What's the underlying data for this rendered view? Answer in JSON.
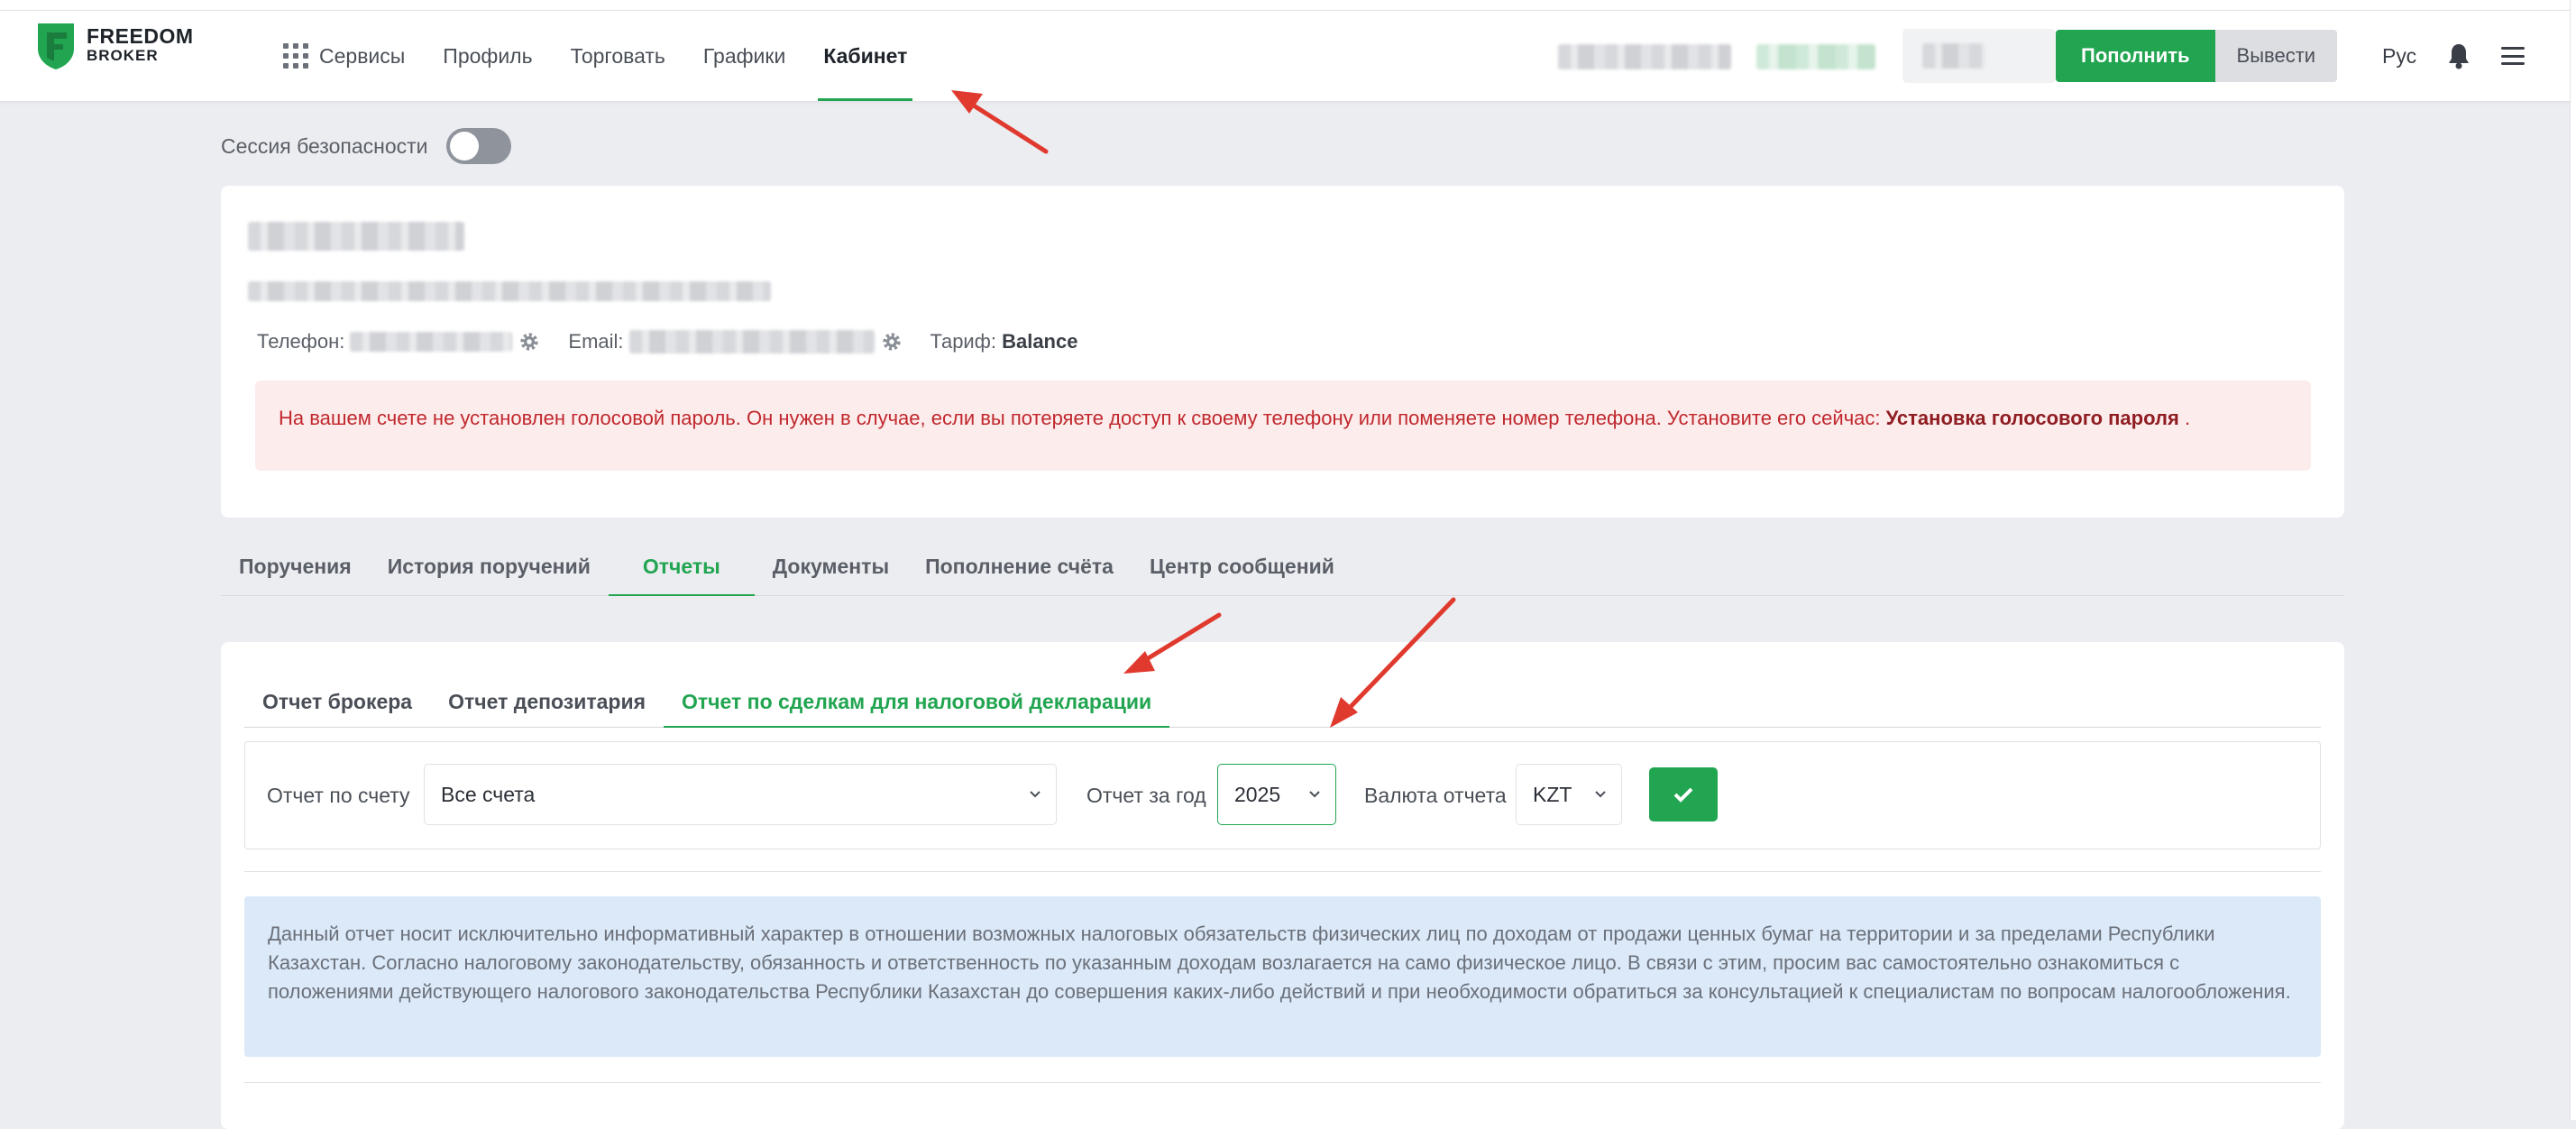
{
  "brand": {
    "line1": "FREEDOM",
    "line2": "BROKER",
    "colors": {
      "accent": "#21a550",
      "alert_text": "#c0282d",
      "info_bg": "#dbe9f9"
    }
  },
  "nav": {
    "services": "Сервисы",
    "profile": "Профиль",
    "trade": "Торговать",
    "charts": "Графики",
    "cabinet": "Кабинет"
  },
  "header": {
    "topup": "Пополнить",
    "withdraw": "Вывести",
    "lang": "Рус"
  },
  "session": {
    "label": "Сессия безопасности",
    "enabled": false
  },
  "profile": {
    "phone_label": "Телефон:",
    "email_label": "Email:",
    "tariff_label": "Тариф:",
    "tariff_value": "Balance",
    "alert_text": "На вашем счете не установлен голосовой пароль. Он нужен в случае, если вы потеряете доступ к своему телефону или поменяете номер телефона. Установите его сейчас:",
    "alert_link": "Установка голосового пароля",
    "alert_end": "."
  },
  "tabs": [
    "Поручения",
    "История поручений",
    "Отчеты",
    "Документы",
    "Пополнение счёта",
    "Центр сообщений"
  ],
  "subtabs": [
    "Отчет брокера",
    "Отчет депозитария",
    "Отчет по сделкам для налоговой декларации"
  ],
  "filters": {
    "account_label": "Отчет по счету",
    "account_value": "Все счета",
    "year_label": "Отчет за год",
    "year_value": "2025",
    "currency_label": "Валюта отчета",
    "currency_value": "KZT"
  },
  "info": "Данный отчет носит исключительно информативный характер в отношении возможных налоговых обязательств физических лиц по доходам от продажи ценных бумаг на территории и за пределами Республики Казахстан. Согласно налоговому законодательству, обязанность и ответственность по указанным доходам возлагается на само физическое лицо. В связи с этим, просим вас самостоятельно ознакомиться с положениями действующего налогового законодательства Республики Казахстан до совершения каких-либо действий и при необходимости обратиться за консультацией к специалистам по вопросам налогообложения.",
  "icons": {
    "grid": "grid-icon",
    "gear": "gear-icon",
    "bell": "bell-icon",
    "menu": "menu-icon",
    "check": "check-icon",
    "chevron": "chevron-down-icon"
  }
}
